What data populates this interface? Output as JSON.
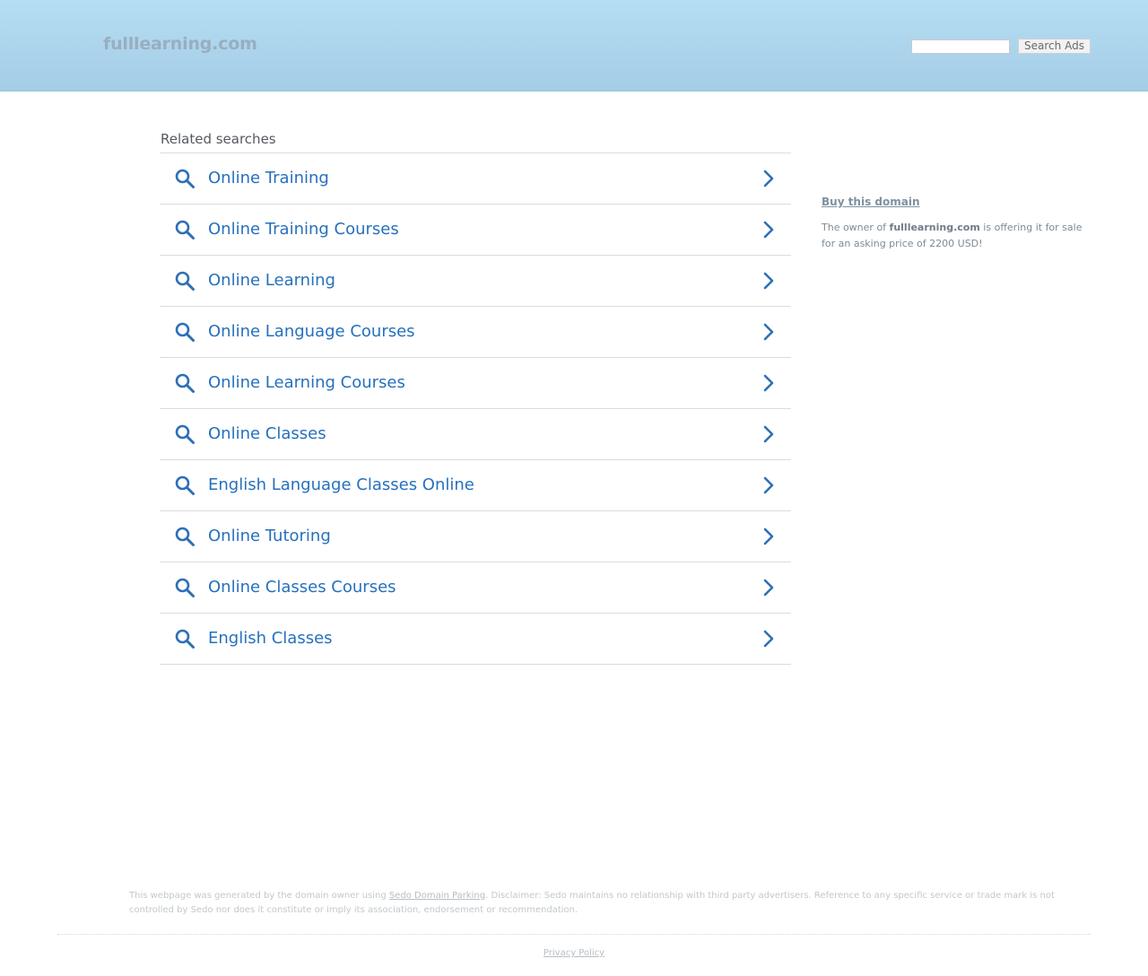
{
  "header": {
    "logo": "fulllearning.com",
    "search": {
      "value": "",
      "placeholder": "",
      "button_label": "Search Ads"
    }
  },
  "main": {
    "related_title": "Related searches",
    "results": [
      {
        "label": "Online Training"
      },
      {
        "label": "Online Training Courses"
      },
      {
        "label": "Online Learning"
      },
      {
        "label": "Online Language Courses"
      },
      {
        "label": "Online Learning Courses"
      },
      {
        "label": "Online Classes"
      },
      {
        "label": "English Language Classes Online"
      },
      {
        "label": "Online Tutoring"
      },
      {
        "label": "Online Classes Courses"
      },
      {
        "label": "English Classes"
      }
    ]
  },
  "sidebar": {
    "buy_link": "Buy this domain",
    "offer_prefix": "The owner of ",
    "offer_domain": "fulllearning.com",
    "offer_suffix": " is offering it for sale for an asking price of 2200 USD!"
  },
  "footer": {
    "disclaimer_prefix": "This webpage was generated by the domain owner using ",
    "disclaimer_link": "Sedo Domain Parking",
    "disclaimer_suffix": ". Disclaimer: Sedo maintains no relationship with third party advertisers. Reference to any specific service or trade mark is not controlled by Sedo nor does it constitute or imply its association, endorsement or recommendation.",
    "privacy_link": "Privacy Policy"
  },
  "colors": {
    "header_top": "#b5def4",
    "header_bottom": "#a4cde6",
    "link_blue": "#2670bd",
    "icon_blue": "#2e6fb8"
  },
  "icons": {
    "result_icon": "search-icon",
    "result_arrow": "chevron-right-icon"
  }
}
